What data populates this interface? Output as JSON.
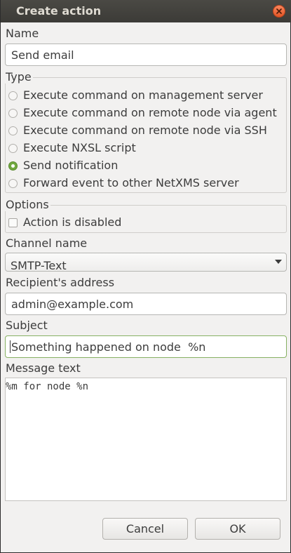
{
  "window": {
    "title": "Create action"
  },
  "name": {
    "label": "Name",
    "value": "Send email"
  },
  "type": {
    "label": "Type",
    "options": [
      "Execute command on management server",
      "Execute command on remote node via agent",
      "Execute command on remote node via SSH",
      "Execute NXSL script",
      "Send notification",
      "Forward event to other NetXMS server"
    ],
    "selected": "Send notification"
  },
  "options": {
    "label": "Options",
    "disabled_label": "Action is disabled",
    "disabled_checked": false
  },
  "channel": {
    "label": "Channel name",
    "value": "SMTP-Text"
  },
  "recipient": {
    "label": "Recipient's address",
    "value": "admin@example.com"
  },
  "subject": {
    "label": "Subject",
    "value": "Something happened on node  %n"
  },
  "message": {
    "label": "Message text",
    "value": "%m for node %n"
  },
  "buttons": {
    "cancel": "Cancel",
    "ok": "OK"
  },
  "colors": {
    "accent": "#70a83f",
    "titlebar": "#3c3b37",
    "close": "#e9652d"
  }
}
